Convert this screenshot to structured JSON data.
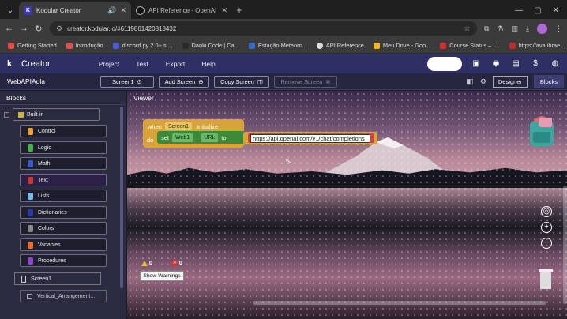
{
  "browser": {
    "tabs": [
      {
        "title": "Kodular Creator",
        "active": true,
        "favicon": "K"
      },
      {
        "title": "API Reference - OpenAI API",
        "active": false
      }
    ],
    "url": "creator.kodular.io/#6119861420818432",
    "bookmarks": [
      {
        "label": "Getting Started",
        "color": "#e0484a"
      },
      {
        "label": "Introdução",
        "color": "#d95050"
      },
      {
        "label": "discord.py 2.0+ sl...",
        "color": "#4a5ad8"
      },
      {
        "label": "Danki Code | Ca...",
        "color": "#2a2a2a"
      },
      {
        "label": "Estação Meteoro...",
        "color": "#3a68c8"
      },
      {
        "label": "API Reference",
        "color": "#dddddd"
      },
      {
        "label": "Meu Drive - Goo...",
        "color": "#f2b620"
      },
      {
        "label": "Course Status – I...",
        "color": "#d03030"
      },
      {
        "label": "https://ava.ibrae...",
        "color": "#c02a2a"
      }
    ]
  },
  "app": {
    "name": "Creator",
    "logo": "k",
    "menu": [
      "Project",
      "Test",
      "Export",
      "Help"
    ]
  },
  "toolbar": {
    "project_name": "WebAPIAula",
    "screen": "Screen1",
    "add_screen": "Add Screen",
    "copy_screen": "Copy Screen",
    "remove_screen": "Remove Screen",
    "designer": "Designer",
    "blocks": "Blocks"
  },
  "blocks_panel": {
    "title": "Blocks",
    "builtin": "Built-in",
    "items": [
      {
        "label": "Control",
        "color": "#e8a33a"
      },
      {
        "label": "Logic",
        "color": "#4ab04a"
      },
      {
        "label": "Math",
        "color": "#3a5ac8"
      },
      {
        "label": "Text",
        "color": "#c23a3a"
      },
      {
        "label": "Lists",
        "color": "#7ab8e8"
      },
      {
        "label": "Dictionaries",
        "color": "#2a3a9a"
      },
      {
        "label": "Colors",
        "color": "#888888"
      },
      {
        "label": "Variables",
        "color": "#e07030"
      },
      {
        "label": "Procedures",
        "color": "#8a4ac8"
      }
    ],
    "screen1": "Screen1",
    "vertical": "Vertical_Arrangement..."
  },
  "viewer": {
    "title": "Viewer",
    "event_when": "when",
    "event_component": "Screen1",
    "event_name": ".Initialize",
    "do": "do",
    "set": "set",
    "set_component": "Web1",
    "set_property": "URL",
    "set_to": "to",
    "url_value": "https://api.openai.com/v1/chat/completions",
    "warnings_count": "0",
    "errors_count": "0",
    "show_warnings": "Show Warnings"
  }
}
